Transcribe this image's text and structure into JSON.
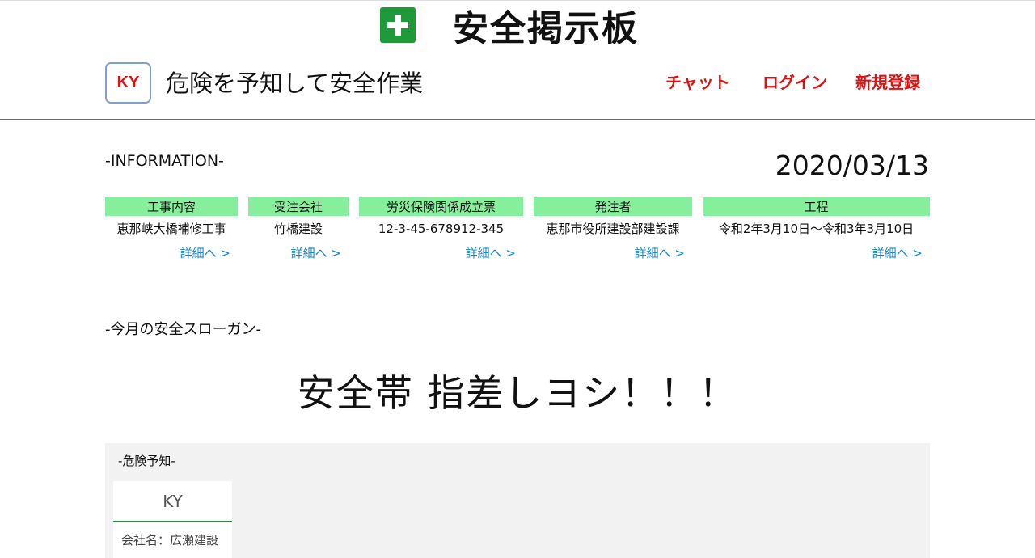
{
  "header": {
    "site_title": "安全掲示板",
    "logo_text": "KY",
    "tagline": "危険を予知して安全作業",
    "nav": [
      {
        "label": "チャット"
      },
      {
        "label": "ログイン"
      },
      {
        "label": "新規登録"
      }
    ]
  },
  "information": {
    "heading": "-INFORMATION-",
    "date": "2020/03/13",
    "columns": [
      {
        "header": "工事内容",
        "value": "恵那峡大橋補修工事",
        "link": "詳細へ >"
      },
      {
        "header": "受注会社",
        "value": "竹橋建設",
        "link": "詳細へ >"
      },
      {
        "header": "労災保険関係成立票",
        "value": "12-3-45-678912-345",
        "link": "詳細へ >"
      },
      {
        "header": "発注者",
        "value": "恵那市役所建設部建設課",
        "link": "詳細へ >"
      },
      {
        "header": "工程",
        "value": "令和2年3月10日〜令和3年3月10日",
        "link": "詳細へ >"
      }
    ]
  },
  "slogan": {
    "heading": "-今月の安全スローガン-",
    "text": "安全帯 指差しヨシ！！！"
  },
  "danger_prediction": {
    "heading": "-危険予知-",
    "cards": [
      {
        "title": "KY",
        "company": "会社名：広瀬建設"
      }
    ]
  },
  "colors": {
    "accent_red": "#e01010",
    "header_green": "#86ef9c",
    "cross_green": "#1f9a38",
    "link_blue": "#1a86cf",
    "divider_green": "#2f8a3e"
  }
}
